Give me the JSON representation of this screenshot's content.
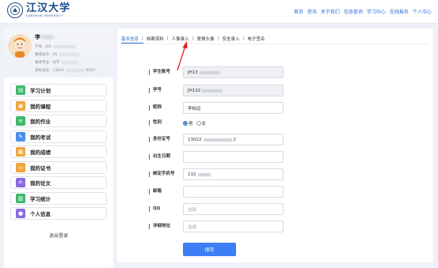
{
  "header": {
    "logo_cn": "江汉大学",
    "logo_en": "JIANGHAN UNIVERSITY",
    "nav": [
      "首页",
      "资讯",
      "关于我们",
      "信息查询",
      "学习中心",
      "在线报名",
      "个人中心"
    ]
  },
  "profile": {
    "name": "李",
    "lines": [
      "学号：JH1",
      "报考层次：20",
      "报考专业：化学",
      "身份证号：13022",
      "8322"
    ]
  },
  "menu": [
    {
      "label": "学习计划",
      "icon": "book-plan-icon",
      "color": "#3cb86a"
    },
    {
      "label": "我的课程",
      "icon": "course-icon",
      "color": "#f0a53a"
    },
    {
      "label": "我的作业",
      "icon": "homework-icon",
      "color": "#3cb86a"
    },
    {
      "label": "我的考试",
      "icon": "exam-pen-icon",
      "color": "#4a8cf0"
    },
    {
      "label": "我的成绩",
      "icon": "score-icon",
      "color": "#f0a53a"
    },
    {
      "label": "我的证书",
      "icon": "certificate-icon",
      "color": "#f0a53a"
    },
    {
      "label": "我的论文",
      "icon": "thesis-icon",
      "color": "#8a6ae0"
    },
    {
      "label": "学习统计",
      "icon": "statistics-icon",
      "color": "#3cb86a"
    },
    {
      "label": "个人信息",
      "icon": "person-icon",
      "color": "#8a6ae0"
    }
  ],
  "logout": "退出登录",
  "tabs": [
    "基本信息",
    "档案资料",
    "人像录入",
    "更换头像",
    "安全录入",
    "电子签名"
  ],
  "form": {
    "student_account_label": "学生账号",
    "student_account_value": "JH13",
    "student_id_label": "学号",
    "student_id_value": "JH132",
    "nickname_label": "昵称",
    "nickname_value": "李柏远",
    "gender_label": "性别",
    "gender_options": [
      "男",
      "女"
    ],
    "gender_selected": "男",
    "idcard_label": "身份证号",
    "idcard_value_start": "13022",
    "idcard_value_end": "2",
    "birthday_label": "出生日期",
    "phone_label": "绑定手机号",
    "phone_value": "132",
    "email_label": "邮箱",
    "qq_label": "QQ",
    "qq_placeholder": "选填",
    "address_label": "详细地址",
    "address_placeholder": "选填"
  },
  "save_label": "保存",
  "colors": {
    "accent": "#2f6fd6",
    "button": "#3d7df5",
    "arrow": "#e02020",
    "brand": "#1b4a8a"
  }
}
